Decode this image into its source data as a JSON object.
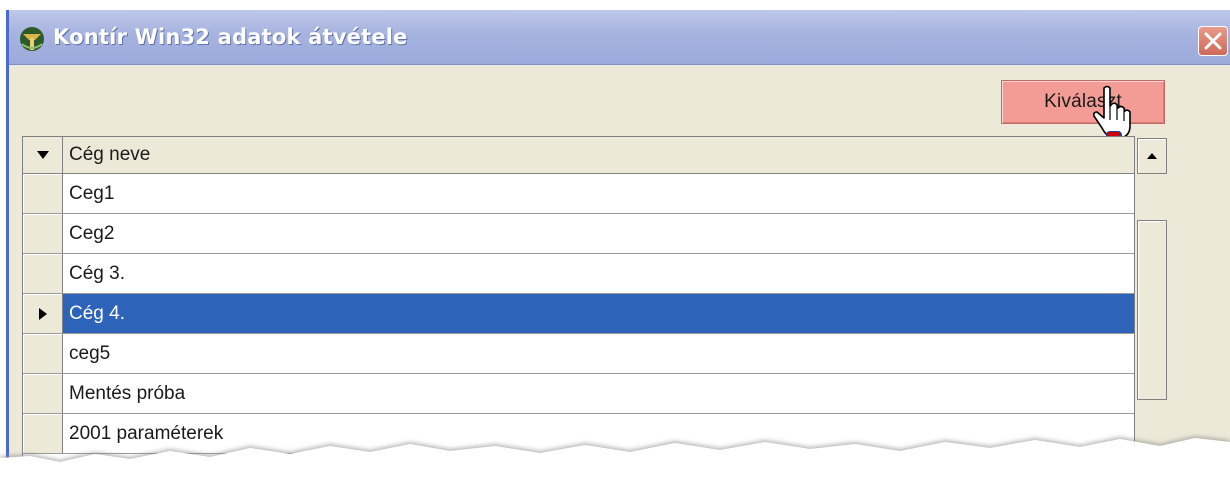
{
  "window": {
    "title": "Kontír Win32 adatok átvétele",
    "app_icon": "app-logo-icon",
    "close_icon": "close-icon"
  },
  "toolbar": {
    "select_label": "Kiválaszt"
  },
  "table": {
    "header_indicator_icon": "dropdown-triangle-icon",
    "column_header": "Cég neve",
    "rows": [
      {
        "name": "Ceg1",
        "selected": false
      },
      {
        "name": "Ceg2",
        "selected": false
      },
      {
        "name": "Cég 3.",
        "selected": false
      },
      {
        "name": "Cég 4.",
        "selected": true
      },
      {
        "name": "ceg5",
        "selected": false
      },
      {
        "name": "Mentés próba",
        "selected": false
      },
      {
        "name": "2001 paraméterek",
        "selected": false
      }
    ]
  },
  "colors": {
    "selection": "#2d63b8",
    "button": "#f29c95",
    "titlebar": "#a6b3e0"
  }
}
